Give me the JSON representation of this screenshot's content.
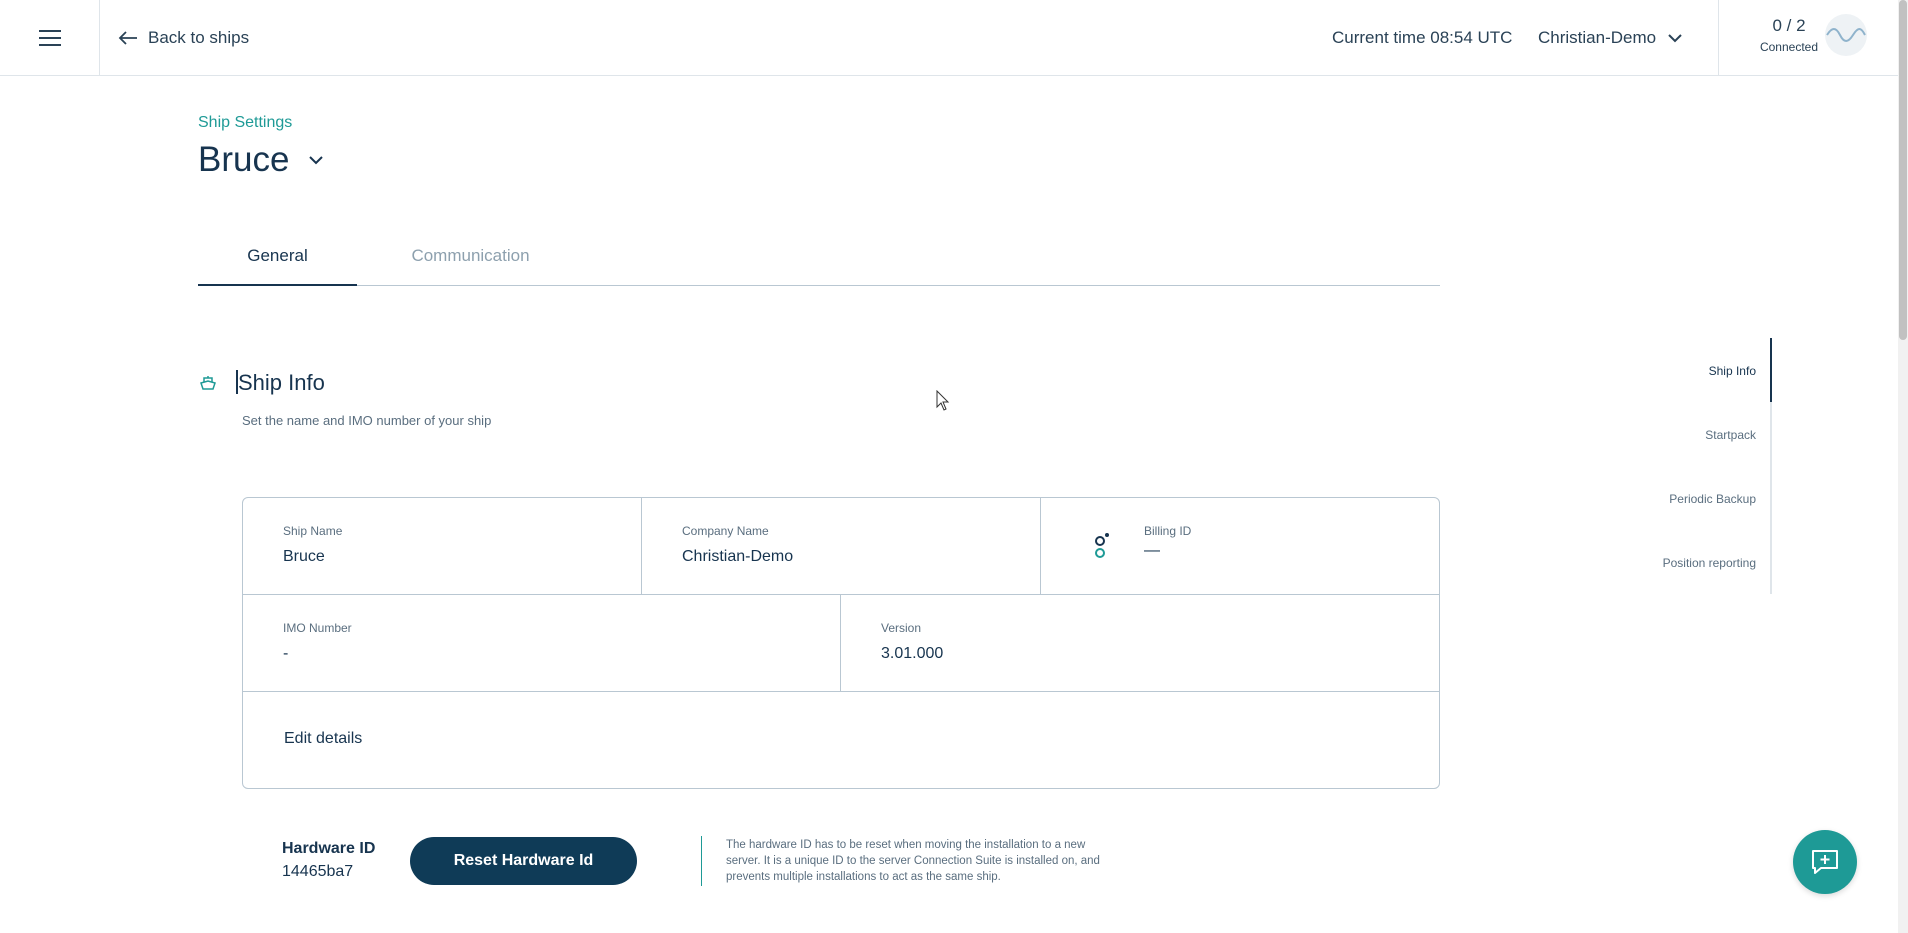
{
  "header": {
    "back_label": "Back to ships",
    "current_time": "Current time 08:54 UTC",
    "company": "Christian-Demo",
    "connection_count": "0 / 2",
    "connection_label": "Connected"
  },
  "page": {
    "breadcrumb": "Ship Settings",
    "ship_name": "Bruce"
  },
  "tabs": [
    {
      "label": "General",
      "active": true
    },
    {
      "label": "Communication",
      "active": false
    }
  ],
  "section": {
    "title": "Ship Info",
    "subtitle": "Set the name and IMO number of your ship"
  },
  "card": {
    "ship_name_label": "Ship Name",
    "ship_name_value": "Bruce",
    "company_label": "Company Name",
    "company_value": "Christian-Demo",
    "billing_label": "Billing ID",
    "billing_value": "—",
    "imo_label": "IMO Number",
    "imo_value": "-",
    "version_label": "Version",
    "version_value": "3.01.000",
    "edit_label": "Edit details"
  },
  "hardware": {
    "label": "Hardware ID",
    "value": "14465ba7",
    "reset_label": "Reset Hardware Id",
    "description": "The hardware ID has to be reset when moving the installation to a new server. It is a unique ID to the server Connection Suite is installed on, and prevents multiple installations to act as the same ship."
  },
  "anchor_nav": [
    {
      "label": "Ship Info",
      "active": true
    },
    {
      "label": "Startpack",
      "active": false
    },
    {
      "label": "Periodic Backup",
      "active": false
    },
    {
      "label": "Position reporting",
      "active": false
    }
  ],
  "colors": {
    "primary": "#0f3b57",
    "accent": "#1e9a96",
    "text": "#17344f",
    "muted": "#5a6e7f",
    "border": "#b9c7d2"
  },
  "icons": {
    "menu": "hamburger-menu-icon",
    "back": "arrow-left-icon",
    "dropdown": "chevron-down-icon",
    "connection": "wave-icon",
    "section": "ship-icon",
    "billing": "billing-link-icon",
    "chat": "chat-add-icon"
  }
}
